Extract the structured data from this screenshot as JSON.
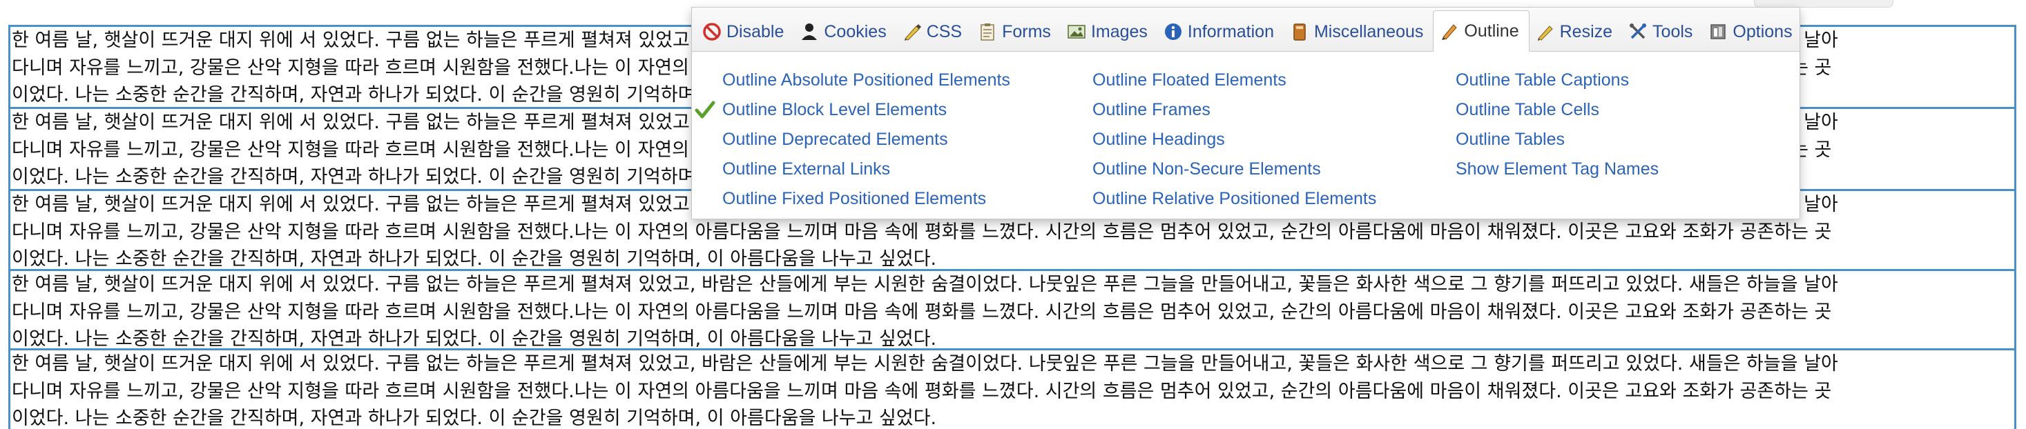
{
  "content": {
    "line1": "한 여름 날, 햇살이 뜨거운 대지 위에 서 있었다. 구름 없는 하늘은 푸르게 펼쳐져 있었고, 바람은 산들에게 부는 시원한 숨결이었다. 나뭇잎은 푸른 그늘을 만들어내고, 꽃들은 화사한 색으로 그 향기를 퍼뜨리고 있었다. 새들은 하늘을 날아",
    "line2": "다니며 자유를 느끼고, 강물은 산악 지형을 따라 흐르며 시원함을 전했다.나는 이 자연의 아름다움을 느끼며 마음 속에 평화를 느꼈다. 시간의 흐름은 멈추어 있었고, 순간의 아름다움에 마음이 채워졌다. 이곳은 고요와 조화가 공존하는 곳",
    "line3": "이었다. 나는 소중한 순간을 간직하며, 자연과 하나가 되었다. 이 순간을 영원히 기억하며, 이 아름다움을 나누고 싶었다."
  },
  "toolbar": {
    "tabs": [
      {
        "label": "Disable",
        "icon": "disable-icon"
      },
      {
        "label": "Cookies",
        "icon": "cookies-icon"
      },
      {
        "label": "CSS",
        "icon": "css-icon"
      },
      {
        "label": "Forms",
        "icon": "forms-icon"
      },
      {
        "label": "Images",
        "icon": "images-icon"
      },
      {
        "label": "Information",
        "icon": "information-icon"
      },
      {
        "label": "Miscellaneous",
        "icon": "miscellaneous-icon"
      },
      {
        "label": "Outline",
        "icon": "outline-icon",
        "active": true
      },
      {
        "label": "Resize",
        "icon": "resize-icon"
      },
      {
        "label": "Tools",
        "icon": "tools-icon"
      },
      {
        "label": "Options",
        "icon": "options-icon"
      }
    ]
  },
  "outline_menu": {
    "col1": [
      {
        "label": "Outline Absolute Positioned Elements",
        "checked": false
      },
      {
        "label": "Outline Block Level Elements",
        "checked": true
      },
      {
        "label": "Outline Deprecated Elements",
        "checked": false
      },
      {
        "label": "Outline External Links",
        "checked": false
      },
      {
        "label": "Outline Fixed Positioned Elements",
        "checked": false
      }
    ],
    "col2": [
      {
        "label": "Outline Floated Elements"
      },
      {
        "label": "Outline Frames"
      },
      {
        "label": "Outline Headings"
      },
      {
        "label": "Outline Non-Secure Elements"
      },
      {
        "label": "Outline Relative Positioned Elements"
      }
    ],
    "col3": [
      {
        "label": "Outline Table Captions"
      },
      {
        "label": "Outline Table Cells"
      },
      {
        "label": "Outline Tables"
      },
      {
        "label": "Show Element Tag Names"
      }
    ]
  },
  "colors": {
    "outline_border": "#4a90c8",
    "link": "#2a63b8",
    "check": "#5aa02c"
  }
}
